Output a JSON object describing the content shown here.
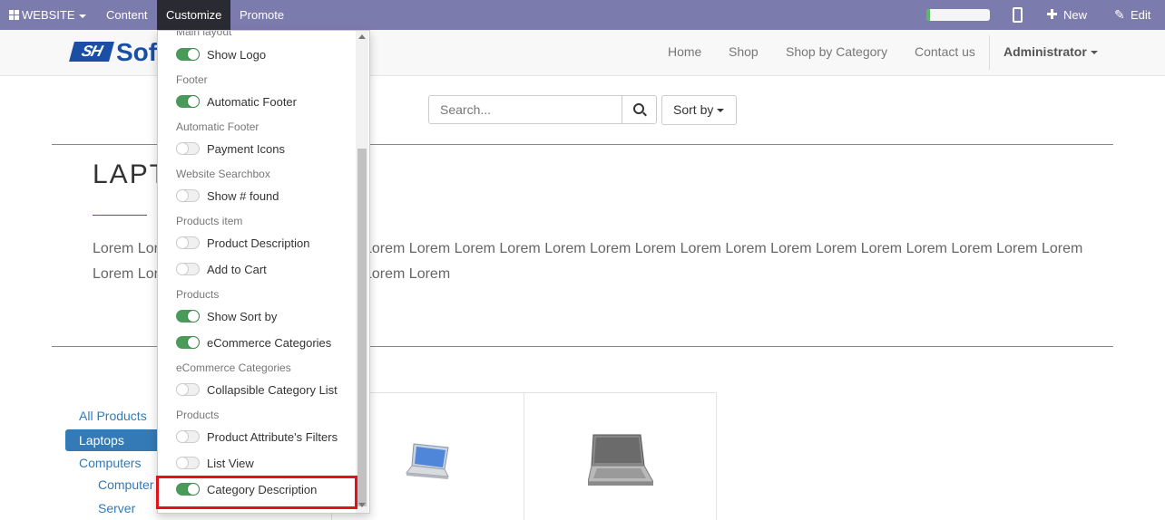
{
  "admin_bar": {
    "website_label": "WEBSITE",
    "content_label": "Content",
    "customize_label": "Customize",
    "promote_label": "Promote",
    "progress_fraction": 0.06,
    "new_label": "New",
    "edit_label": "Edit"
  },
  "site_nav": {
    "logo_text": "Sof",
    "logo_mark": "SH",
    "links": [
      "Home",
      "Shop",
      "Shop by Category",
      "Contact us"
    ],
    "user_label": "Administrator"
  },
  "search": {
    "placeholder": "Search...",
    "sort_label": "Sort by"
  },
  "category": {
    "title": "LAPT",
    "lorem_line1_left": "Lorem Lor",
    "lorem_line1_right": "Lorem Lorem Lorem Lorem Lorem Lorem Lorem Lorem Lorem Lorem Lorem Lorem Lorem Lorem Lorem Lorem",
    "lorem_line2_left": "Lorem Lor",
    "lorem_line2_right": "Lorem Lorem"
  },
  "sidebar": {
    "items": [
      "All Products",
      "Laptops",
      "Computers",
      "Computer",
      "Server"
    ]
  },
  "customize_menu": {
    "entries": [
      {
        "type": "header",
        "label": "Main layout"
      },
      {
        "type": "toggle",
        "label": "Show Logo",
        "on": true
      },
      {
        "type": "header",
        "label": "Footer"
      },
      {
        "type": "toggle",
        "label": "Automatic Footer",
        "on": true
      },
      {
        "type": "header",
        "label": "Automatic Footer"
      },
      {
        "type": "toggle",
        "label": "Payment Icons",
        "on": false
      },
      {
        "type": "header",
        "label": "Website Searchbox"
      },
      {
        "type": "toggle",
        "label": "Show # found",
        "on": false
      },
      {
        "type": "header",
        "label": "Products item"
      },
      {
        "type": "toggle",
        "label": "Product Description",
        "on": false
      },
      {
        "type": "toggle",
        "label": "Add to Cart",
        "on": false
      },
      {
        "type": "header",
        "label": "Products"
      },
      {
        "type": "toggle",
        "label": "Show Sort by",
        "on": true
      },
      {
        "type": "toggle",
        "label": "eCommerce Categories",
        "on": true
      },
      {
        "type": "header",
        "label": "eCommerce Categories"
      },
      {
        "type": "toggle",
        "label": "Collapsible Category List",
        "on": false
      },
      {
        "type": "header",
        "label": "Products"
      },
      {
        "type": "toggle",
        "label": "Product Attribute's Filters",
        "on": false
      },
      {
        "type": "toggle",
        "label": "List View",
        "on": false
      },
      {
        "type": "toggle",
        "label": "Category Description",
        "on": true
      }
    ]
  },
  "colors": {
    "admin_bar": "#7c7bad",
    "toggle_on": "#4a9a5a",
    "link": "#337ab7",
    "highlight": "#e0121b"
  }
}
